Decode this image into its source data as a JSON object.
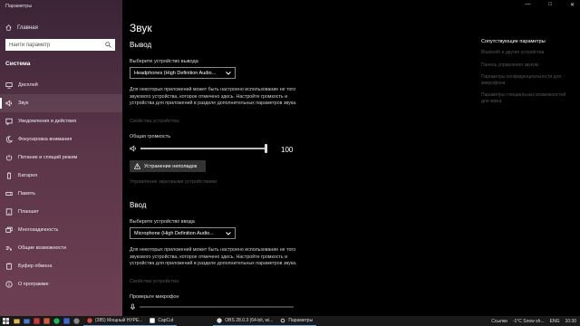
{
  "window": {
    "title": "Параметры",
    "controls": [
      "—",
      "□",
      "✕"
    ]
  },
  "sidebar": {
    "home_label": "Главная",
    "search_placeholder": "Найти параметр",
    "section_label": "Система",
    "items": [
      {
        "label": "Дисплей",
        "icon": "display-icon"
      },
      {
        "label": "Звук",
        "icon": "speaker-icon",
        "active": true
      },
      {
        "label": "Уведомления и действия",
        "icon": "notification-icon"
      },
      {
        "label": "Фокусировка внимания",
        "icon": "moon-icon"
      },
      {
        "label": "Питание и спящий режим",
        "icon": "power-icon"
      },
      {
        "label": "Батарея",
        "icon": "battery-icon"
      },
      {
        "label": "Память",
        "icon": "storage-icon"
      },
      {
        "label": "Планшет",
        "icon": "tablet-icon"
      },
      {
        "label": "Многозадачность",
        "icon": "multitask-icon"
      },
      {
        "label": "Общие возможности",
        "icon": "share-icon"
      },
      {
        "label": "Буфер обмена",
        "icon": "clipboard-icon"
      },
      {
        "label": "О программе",
        "icon": "info-icon"
      }
    ]
  },
  "main": {
    "title": "Звук",
    "output": {
      "heading": "Вывод",
      "device_label": "Выберите устройство вывода",
      "device_value": "Headphones (High Definition Audio...",
      "description": "Для некоторых приложений может быть настроено использование не того звукового устройства, которое отмечено здесь. Настройте громкость и устройства для приложений в разделе дополнительных параметров звука.",
      "device_props_link": "Свойства устройства",
      "volume_label": "Общая громкость",
      "volume_value": "100",
      "volume_fraction": 1.0,
      "troubleshoot_label": "Устранение неполадок",
      "manage_devices_link": "Управление звуковыми устройствами"
    },
    "input": {
      "heading": "Ввод",
      "device_label": "Выберите устройство ввода",
      "device_value": "Microphone (High Definition Audio...",
      "description": "Для некоторых приложений может быть настроено использование не того звукового устройства, которое отмечено здесь. Настройте громкость и устройства для приложений в разделе дополнительных параметров звука.",
      "device_props_link": "Свойства устройства",
      "mic_test_label": "Проверьте микрофон"
    }
  },
  "related": {
    "title": "Сопутствующие параметры",
    "links": [
      "Bluetooth и другие устройства",
      "Панель управления звуком",
      "Параметры конфиденциальности для микрофона",
      "Параметры специальных возможностей для звука"
    ]
  },
  "taskbar": {
    "apps": [
      {
        "label": "(385) Мощный НУРЕ..."
      },
      {
        "label": "CapCut"
      },
      {
        "label": "OBS 28.0.3 (64-bit, wi..."
      },
      {
        "label": "Параметры"
      }
    ],
    "links_label": "Ссылки",
    "weather": "-1°C  Snow sh...",
    "lang": "ENG",
    "time": "10:30"
  },
  "colors": {
    "accent": "#6aa0d8",
    "sidebar_top": "#3a2436",
    "sidebar_bottom": "#6e3f52"
  }
}
